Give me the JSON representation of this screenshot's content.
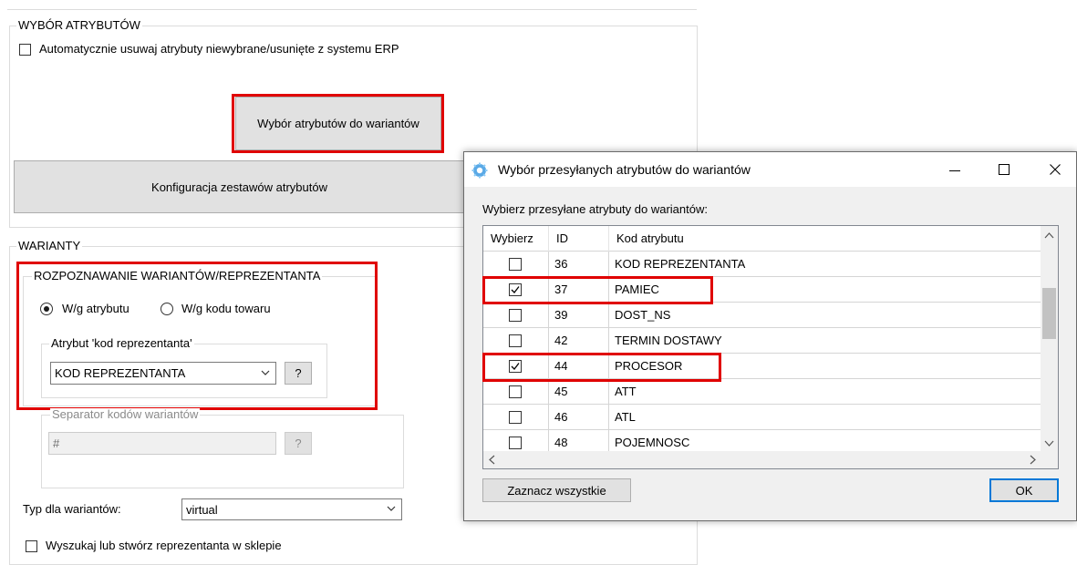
{
  "main": {
    "attr_group": {
      "title": "WYBÓR ATRYBUTÓW",
      "auto_remove_label": "Automatycznie usuwaj atrybuty niewybrane/usunięte z systemu ERP",
      "variant_attrs_button": "Wybór atrybutów do wariantów",
      "attr_sets_button": "Konfiguracja zestawów atrybutów"
    },
    "variants": {
      "title": "WARIANTY",
      "recognition": {
        "title": "ROZPOZNAWANIE WARIANTÓW/REPREZENTANTA",
        "radio_attr": "W/g atrybutu",
        "radio_code": "W/g kodu towaru",
        "rep_attr_group": "Atrybut 'kod reprezentanta'",
        "rep_attr_value": "KOD REPREZENTANTA",
        "help_label": "?"
      },
      "separator": {
        "title": "Separator kodów wariantów",
        "value": "#",
        "help_label": "?"
      },
      "type_label": "Typ dla wariantów:",
      "type_value": "virtual",
      "find_create_label": "Wyszukaj lub stwórz reprezentanta w sklepie"
    }
  },
  "dialog": {
    "title": "Wybór przesyłanych atrybutów do wariantów",
    "instruction": "Wybierz przesyłane atrybuty do wariantów:",
    "columns": [
      "Wybierz",
      "ID",
      "Kod atrybutu"
    ],
    "rows": [
      {
        "checked": false,
        "id": "36",
        "code": "KOD REPREZENTANTA"
      },
      {
        "checked": true,
        "id": "37",
        "code": "PAMIEC"
      },
      {
        "checked": false,
        "id": "39",
        "code": "DOST_NS"
      },
      {
        "checked": false,
        "id": "42",
        "code": "TERMIN DOSTAWY"
      },
      {
        "checked": true,
        "id": "44",
        "code": "PROCESOR"
      },
      {
        "checked": false,
        "id": "45",
        "code": "ATT"
      },
      {
        "checked": false,
        "id": "46",
        "code": "ATL"
      },
      {
        "checked": false,
        "id": "48",
        "code": "POJEMNOSC"
      }
    ],
    "select_all_button": "Zaznacz wszystkie",
    "ok_button": "OK"
  },
  "colors": {
    "highlight": "#e00000",
    "dialog_bg": "#f0f0f0",
    "accent_border": "#0078d7"
  }
}
